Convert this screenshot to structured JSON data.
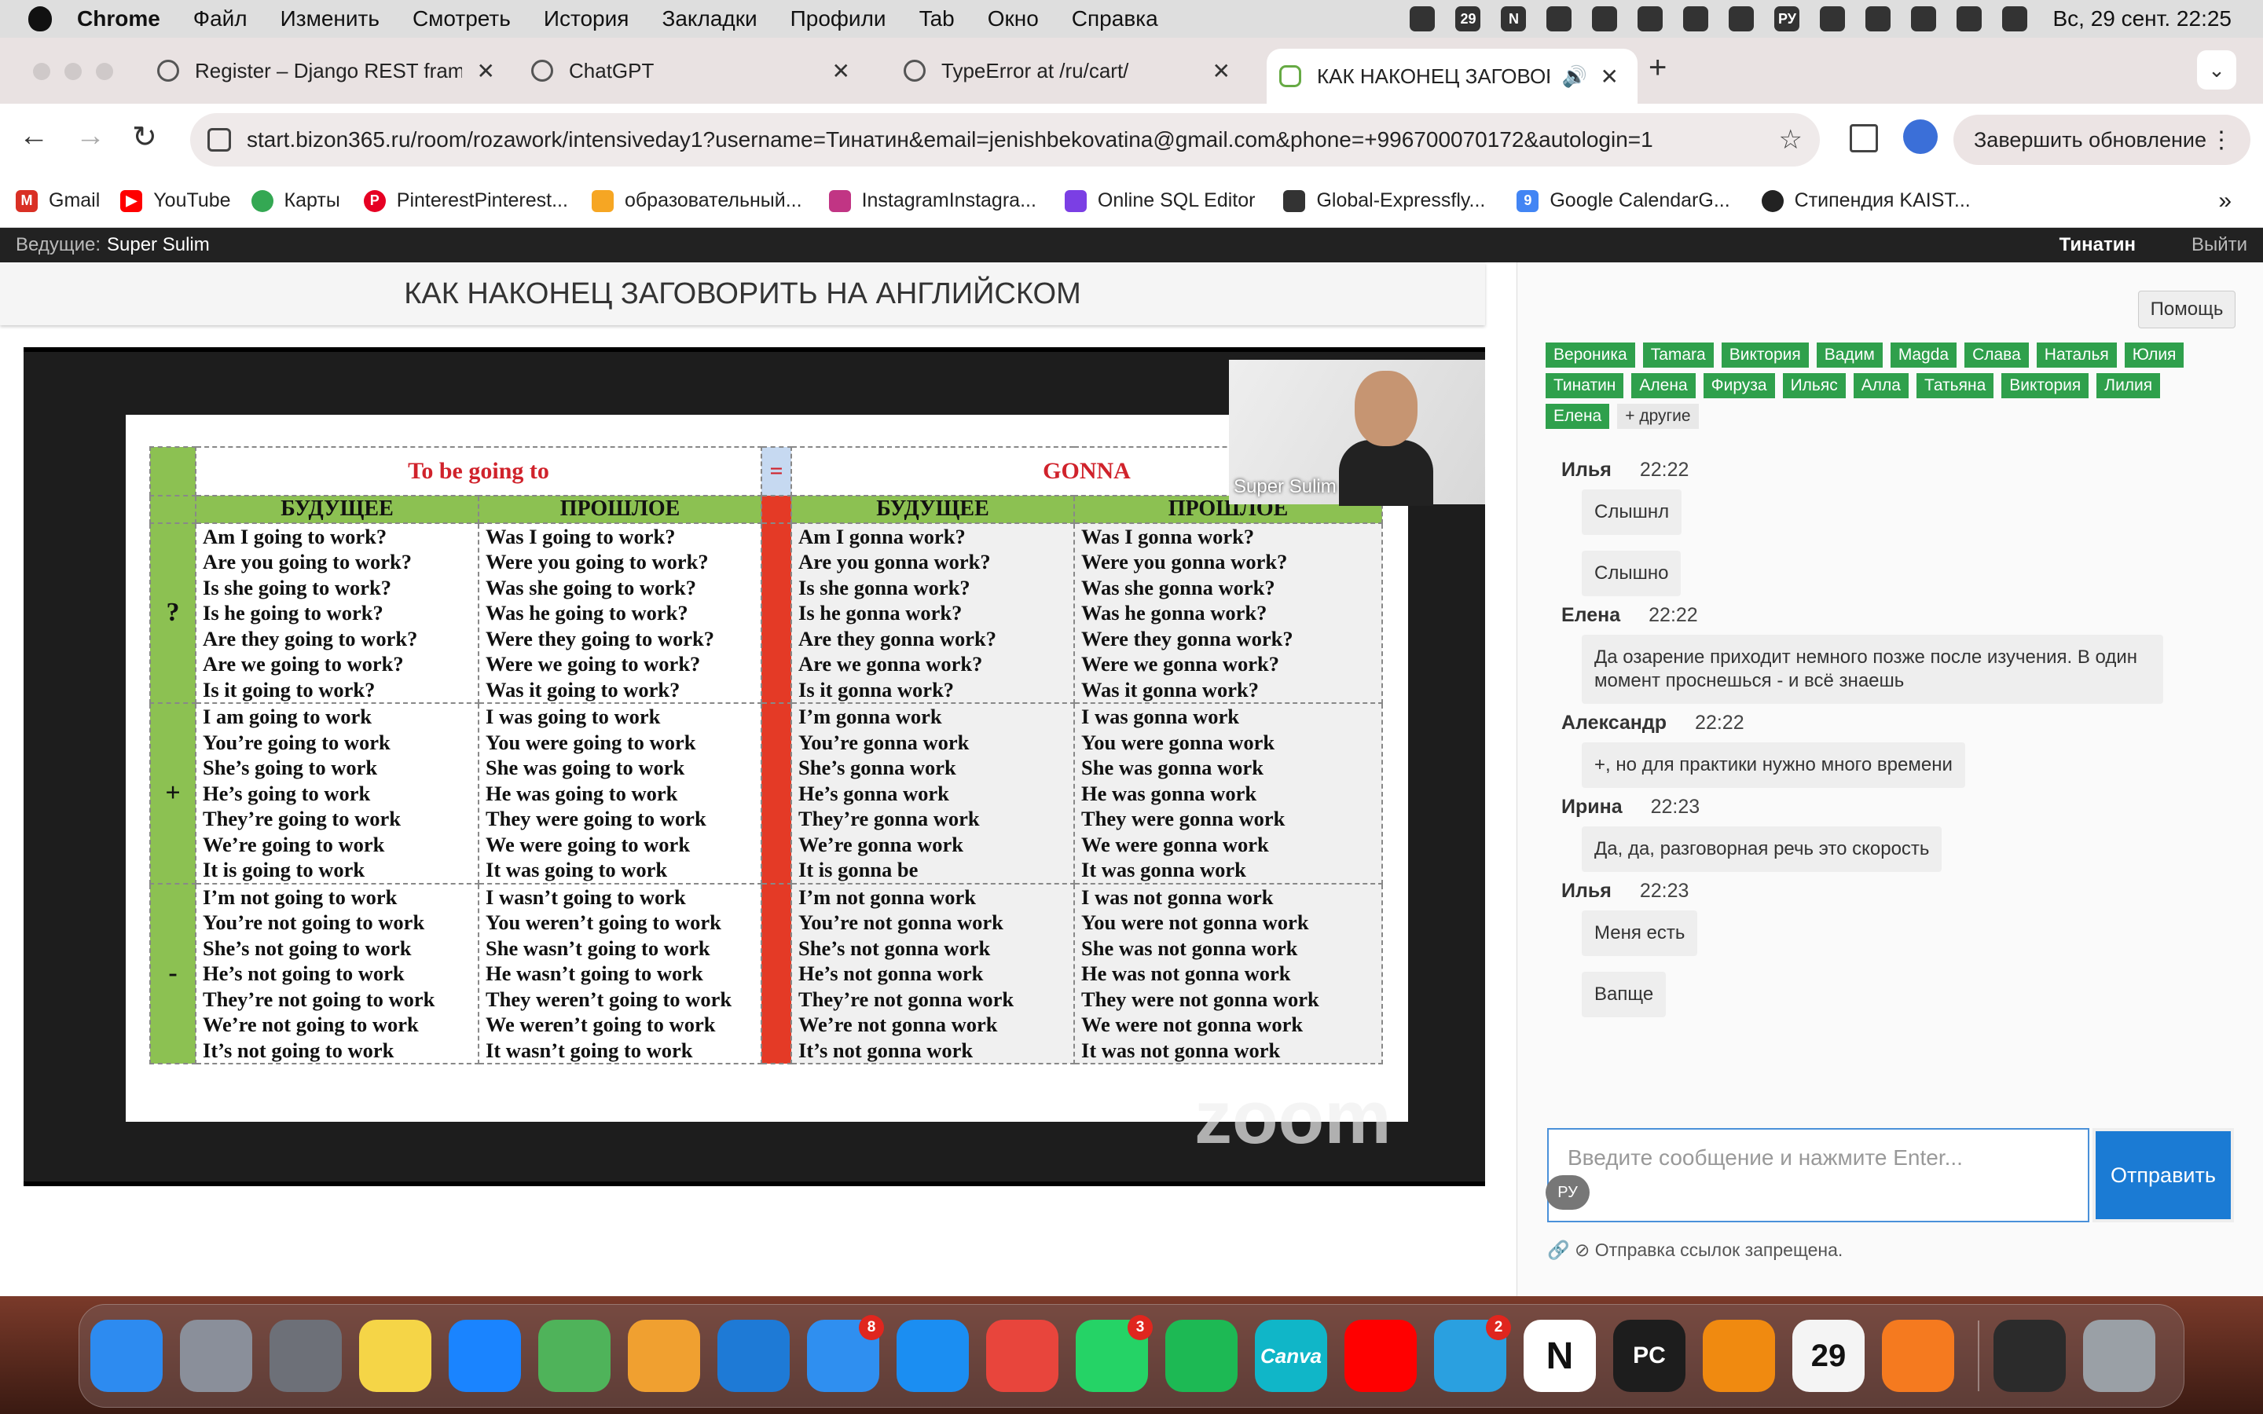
{
  "menubar": {
    "app": "Chrome",
    "items": [
      "Файл",
      "Изменить",
      "Смотреть",
      "История",
      "Закладки",
      "Профили",
      "Tab",
      "Окно",
      "Справка"
    ],
    "tray_badges": [
      "29",
      "N",
      "РУ"
    ],
    "clock": "Вс, 29 сент.  22:25"
  },
  "tabs": [
    {
      "title": "Register – Django REST framework",
      "close": "✕"
    },
    {
      "title": "ChatGPT",
      "close": "✕"
    },
    {
      "title": "TypeError at /ru/cart/",
      "close": "✕"
    },
    {
      "title": "КАК НАКОНЕЦ ЗАГОВОРИТЬ",
      "close": "✕",
      "active": true
    }
  ],
  "toolbar": {
    "url": "start.bizon365.ru/room/rozawork/intensiveday1?username=Тинатин&email=jenishbekovatina@gmail.com&phone=+996700070172&autologin=1",
    "update_label": "Завершить обновление",
    "new_tab": "+",
    "back": "←",
    "forward": "→",
    "reload": "↻"
  },
  "bookmarks": [
    "Gmail",
    "YouTube",
    "Карты",
    "PinterestPinterest...",
    "образовательный...",
    "InstagramInstagra...",
    "Online SQL Editor",
    "Global-Expressfly...",
    "Google CalendarG...",
    "Стипендия KAIST..."
  ],
  "room": {
    "host_label": "Ведущие:",
    "host_name": "Super Sulim",
    "user_name": "Тинатин",
    "logout_label": "Выйти",
    "title": "КАК НАКОНЕЦ ЗАГОВОРИТЬ НА АНГЛИЙСКОМ",
    "cam_name": "Super Sulim",
    "watermark": "zoom"
  },
  "slide": {
    "title_left": "To be going to",
    "equals": "=",
    "title_right": "GONNA",
    "headers": [
      "БУДУЩЕЕ",
      "ПРОШЛОЕ",
      "БУДУЩЕЕ",
      "ПРОШЛОЕ"
    ],
    "signs": [
      "?",
      "+",
      "-"
    ],
    "rows": [
      [
        "Am I going to work?\nAre you going to work?\nIs she going to work?\nIs he going to work?\nAre they going to work?\nAre we going to work?\nIs it going to work?",
        "Was I going to work?\nWere you going to work?\nWas she going to work?\nWas he going to work?\nWere they going to work?\nWere we going to work?\nWas it going to work?",
        "Am I gonna work?\nAre you gonna work?\nIs she gonna work?\nIs he gonna work?\nAre they gonna work?\nAre we gonna work?\nIs it gonna work?",
        "Was I gonna work?\nWere you gonna work?\nWas she gonna work?\nWas he gonna work?\nWere they gonna work?\nWere we gonna work?\nWas it gonna work?"
      ],
      [
        "I am going to work\nYou’re going to work\nShe’s going to work\nHe’s going to work\nThey’re going to work\nWe’re going to work\nIt is going to work",
        "I was going to work\nYou were going to work\nShe was going to work\nHe was going to work\nThey were going to work\nWe were going to work\nIt was going to work",
        "I’m gonna work\nYou’re gonna work\nShe’s gonna work\nHe’s gonna work\nThey’re gonna work\nWe’re gonna work\nIt is gonna be",
        "I was gonna work\nYou were gonna work\nShe was gonna work\nHe was gonna work\nThey were gonna work\nWe were gonna work\nIt was gonna work"
      ],
      [
        "I’m not going to work\nYou’re not going to work\nShe’s not going to work\nHe’s not going to work\nThey’re not going to work\nWe’re not going to work\nIt’s not going to work",
        "I wasn’t going to work\nYou weren’t going to work\nShe wasn’t going to work\nHe wasn’t going to work\nThey weren’t going to work\nWe weren’t going to work\nIt wasn’t going to work",
        "I’m not gonna work\nYou’re not gonna work\nShe’s not gonna work\nHe’s not gonna work\nThey’re not gonna work\nWe’re not gonna work\nIt’s not gonna work",
        "I was not gonna work\nYou were not gonna work\nShe was not gonna work\nHe was not gonna work\nThey were not gonna work\nWe were not gonna work\nIt was not gonna work"
      ]
    ]
  },
  "chat": {
    "help_label": "Помощь",
    "users": [
      "Вероника",
      "Tamara",
      "Виктория",
      "Вадим",
      "Magda",
      "Слава",
      "Наталья",
      "Юлия",
      "Тинатин",
      "Алена",
      "Фируза",
      "Ильяс",
      "Алла",
      "Татьяна",
      "Виктория",
      "Лилия",
      "Елена"
    ],
    "more_label": "+ другие",
    "messages": [
      {
        "author": "Илья",
        "time": "22:22",
        "bubbles": [
          "Слышнл",
          "Слышно"
        ]
      },
      {
        "author": "Елена",
        "time": "22:22",
        "bubbles": [
          "Да озарение приходит немного позже после изучения. В один момент проснешься - и всё знаешь"
        ]
      },
      {
        "author": "Александр",
        "time": "22:22",
        "bubbles": [
          "+, но для практики нужно много времени"
        ]
      },
      {
        "author": "Ирина",
        "time": "22:23",
        "bubbles": [
          "Да, да, разговорная речь это скорость"
        ]
      },
      {
        "author": "Илья",
        "time": "22:23",
        "bubbles": [
          "Меня есть",
          "Вапще"
        ]
      }
    ],
    "input_placeholder": "Введите сообщение и нажмите Enter...",
    "lang_badge": "РУ",
    "send_label": "Отправить",
    "link_warning": "Отправка ссылок запрещена."
  },
  "dock": {
    "apps": [
      {
        "name": "Finder",
        "color": "#2d8bf0",
        "badge": ""
      },
      {
        "name": "Launchpad",
        "color": "#8a8f9a",
        "badge": ""
      },
      {
        "name": "System Settings",
        "color": "#6d7078",
        "badge": ""
      },
      {
        "name": "Notes",
        "color": "#f5d547",
        "badge": ""
      },
      {
        "name": "Safari",
        "color": "#1a84ff",
        "badge": ""
      },
      {
        "name": "Maps",
        "color": "#4fb35a",
        "badge": ""
      },
      {
        "name": "Photos",
        "color": "#f0a030",
        "badge": ""
      },
      {
        "name": "VS Code",
        "color": "#1e7ad6",
        "badge": ""
      },
      {
        "name": "Mail",
        "color": "#2f8ff0",
        "badge": "8"
      },
      {
        "name": "App Store",
        "color": "#1b8ef2",
        "badge": ""
      },
      {
        "name": "Chrome",
        "color": "#e8453c",
        "badge": ""
      },
      {
        "name": "WhatsApp",
        "color": "#25d366",
        "badge": "3"
      },
      {
        "name": "Spotify",
        "color": "#1db954",
        "badge": ""
      },
      {
        "name": "Canva",
        "color": "#10b6c8",
        "badge": ""
      },
      {
        "name": "YouTube",
        "color": "#ff0000",
        "badge": ""
      },
      {
        "name": "Telegram",
        "color": "#2aa0e0",
        "badge": "2"
      },
      {
        "name": "Notion",
        "color": "#ffffff",
        "badge": ""
      },
      {
        "name": "PyCharm",
        "color": "#1d1d1d",
        "badge": ""
      },
      {
        "name": "VLC",
        "color": "#f08a10",
        "badge": ""
      },
      {
        "name": "Calendar",
        "color": "#f4f4f4",
        "badge": ""
      },
      {
        "name": "Pages",
        "color": "#f57a1f",
        "badge": ""
      }
    ],
    "tail_apps": [
      {
        "name": "Terminal",
        "color": "#2b2b2b"
      },
      {
        "name": "Trash",
        "color": "#9aa0a6"
      }
    ],
    "canva_label": "Canva",
    "notion_label": "N",
    "pycharm_label": "PC",
    "calendar_label": "29"
  }
}
